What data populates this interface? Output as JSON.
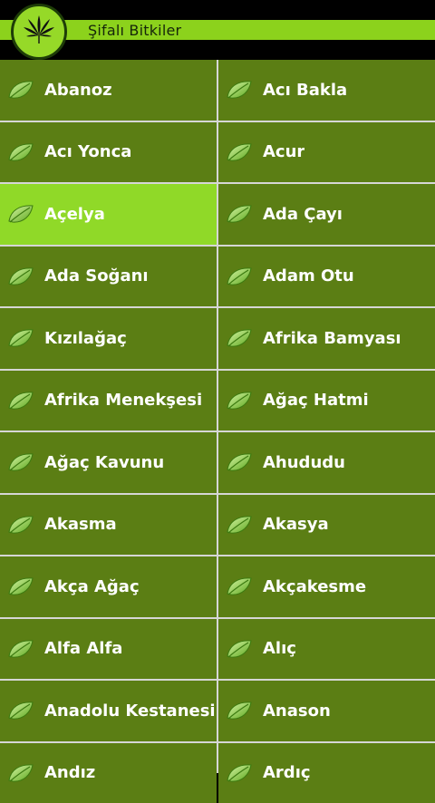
{
  "app": {
    "title": "Şifalı Bitkiler",
    "accent": "#8cd21c",
    "tile_color": "#5b7e14",
    "selected_color": "#90d928",
    "logo_icon": "cannabis-leaf-icon",
    "item_icon": "leaf-icon"
  },
  "items": [
    {
      "label": "Abanoz"
    },
    {
      "label": "Acı Bakla"
    },
    {
      "label": "Acı Yonca"
    },
    {
      "label": "Acur"
    },
    {
      "label": "Açelya",
      "selected": true
    },
    {
      "label": "Ada Çayı"
    },
    {
      "label": "Ada Soğanı"
    },
    {
      "label": "Adam Otu"
    },
    {
      "label": "Kızılağaç"
    },
    {
      "label": "Afrika Bamyası"
    },
    {
      "label": "Afrika Menekşesi"
    },
    {
      "label": "Ağaç Hatmi"
    },
    {
      "label": "Ağaç Kavunu"
    },
    {
      "label": "Ahududu"
    },
    {
      "label": "Akasma"
    },
    {
      "label": "Akasya"
    },
    {
      "label": "Akça Ağaç"
    },
    {
      "label": "Akçakesme"
    },
    {
      "label": "Alfa Alfa"
    },
    {
      "label": "Alıç"
    },
    {
      "label": "Anadolu Kestanesi"
    },
    {
      "label": "Anason"
    },
    {
      "label": "Andız"
    },
    {
      "label": "Ardıç"
    }
  ]
}
